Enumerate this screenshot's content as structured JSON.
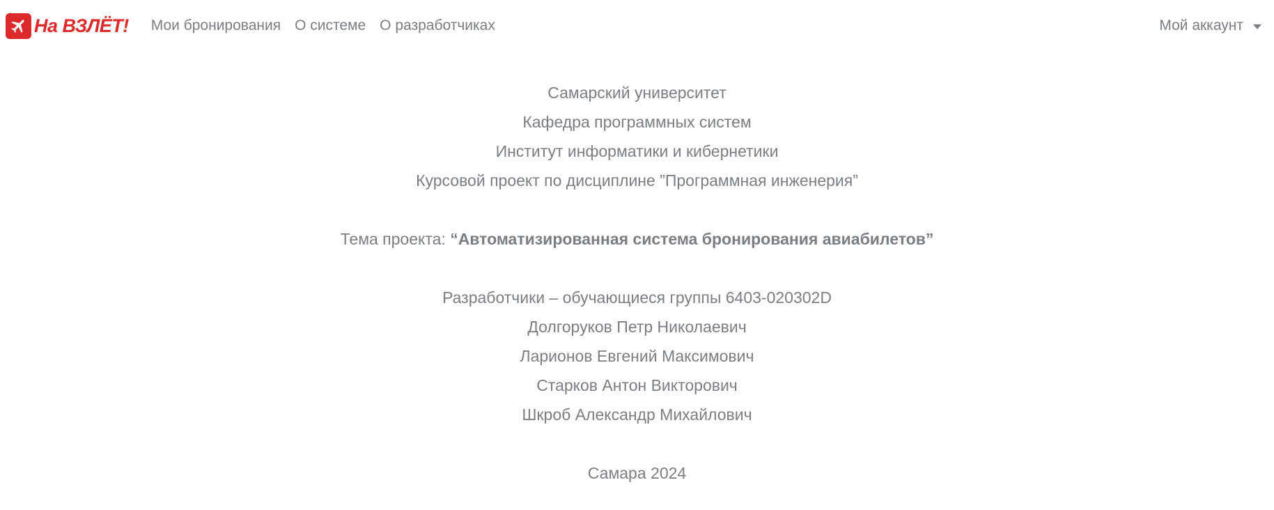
{
  "brand": {
    "text": "На ВЗЛЁТ!",
    "icon": "airplane-icon",
    "color": "#dc2a2a"
  },
  "nav": {
    "links": [
      "Мои бронирования",
      "О системе",
      "О разработчиках"
    ],
    "account": "Мой аккаунт"
  },
  "content": {
    "university": "Самарский университет",
    "department": "Кафедра программных систем",
    "institute": "Институт информатики и кибернетики",
    "course": "Курсовой проект по дисциплине ”Программная инженерия”",
    "topic_label": "Тема проекта: ",
    "topic_title": "“Автоматизированная система бронирования авиабилетов”",
    "developers_heading": "Разработчики – обучающиеся группы 6403-020302D",
    "developers": [
      "Долгоруков Петр Николаевич",
      "Ларионов Евгений Максимович",
      "Старков Антон Викторович",
      "Шкроб Александр Михайлович"
    ],
    "footer": "Самара 2024"
  }
}
